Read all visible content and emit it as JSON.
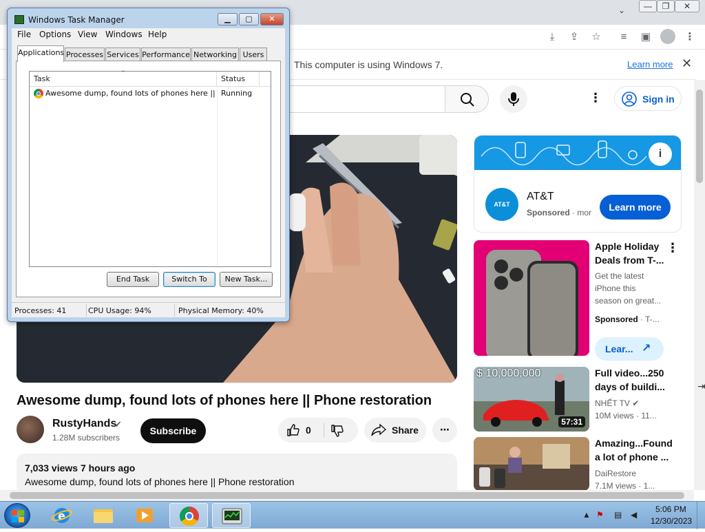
{
  "chrome": {
    "window_controls": {
      "minimize": "—",
      "restore": "❐",
      "close": "✕"
    },
    "toolbar_icons": [
      "install-icon",
      "share-icon",
      "bookmark-star-icon",
      "media-icon",
      "side-panel-icon",
      "profile-icon",
      "menu-dots-icon"
    ],
    "infobar": {
      "text": "This computer is using Windows 7.",
      "link": "Learn more",
      "close": "✕"
    }
  },
  "youtube": {
    "header": {
      "signin": "Sign in"
    },
    "video": {
      "title": "Awesome dump, found lots of phones here || Phone restoration",
      "channel": "RustyHands",
      "subscribers": "1.28M subscribers",
      "subscribe": "Subscribe",
      "likes": "0",
      "share": "Share",
      "views_time": "7,033 views  7 hours ago",
      "description": "Awesome dump, found lots of phones here || Phone restoration"
    },
    "ad": {
      "brand": "AT&T",
      "logo_text": "AT&T",
      "sponsored": "Sponsored",
      "sponsored_more": "· mor",
      "cta": "Learn more"
    },
    "recommendations": [
      {
        "title1": "Apple Holiday",
        "title2": "Deals from T-...",
        "desc1": "Get the latest",
        "desc2": "iPhone this",
        "desc3": "season on great...",
        "sponsored": "Sponsored",
        "sponsored_more": "· T-...",
        "cta": "Lear..."
      },
      {
        "title1": "Full video...250",
        "title2": "days of buildi...",
        "channel": "NHẾT TV",
        "stats": "10M views  · 11...",
        "duration": "57:31",
        "overlay": "$ 10,000,000"
      },
      {
        "title1": "Amazing...Found",
        "title2": "a lot of phone ...",
        "channel": "DaiRestore",
        "stats": "7.1M views  · 1..."
      }
    ]
  },
  "taskmgr": {
    "title": "Windows Task Manager",
    "menu": [
      "File",
      "Options",
      "View",
      "Windows",
      "Help"
    ],
    "tabs": [
      "Applications",
      "Processes",
      "Services",
      "Performance",
      "Networking",
      "Users"
    ],
    "columns": {
      "task": "Task",
      "status": "Status"
    },
    "rows": [
      {
        "task": "Awesome dump, found lots of phones here || Ph...",
        "status": "Running"
      }
    ],
    "buttons": {
      "end_task": "End Task",
      "switch_to": "Switch To",
      "new_task": "New Task..."
    },
    "status": {
      "processes": "Processes: 41",
      "cpu": "CPU Usage: 94%",
      "memory": "Physical Memory: 40%"
    }
  },
  "taskbar": {
    "apps": [
      "internet-explorer-icon",
      "file-explorer-icon",
      "media-player-icon",
      "chrome-icon",
      "task-manager-icon"
    ],
    "time": "5:06 PM",
    "date": "12/30/2023"
  },
  "colors": {
    "youtube_blue": "#065fd4",
    "att_blue": "#1698e4",
    "tmobile_magenta": "#e20074"
  }
}
